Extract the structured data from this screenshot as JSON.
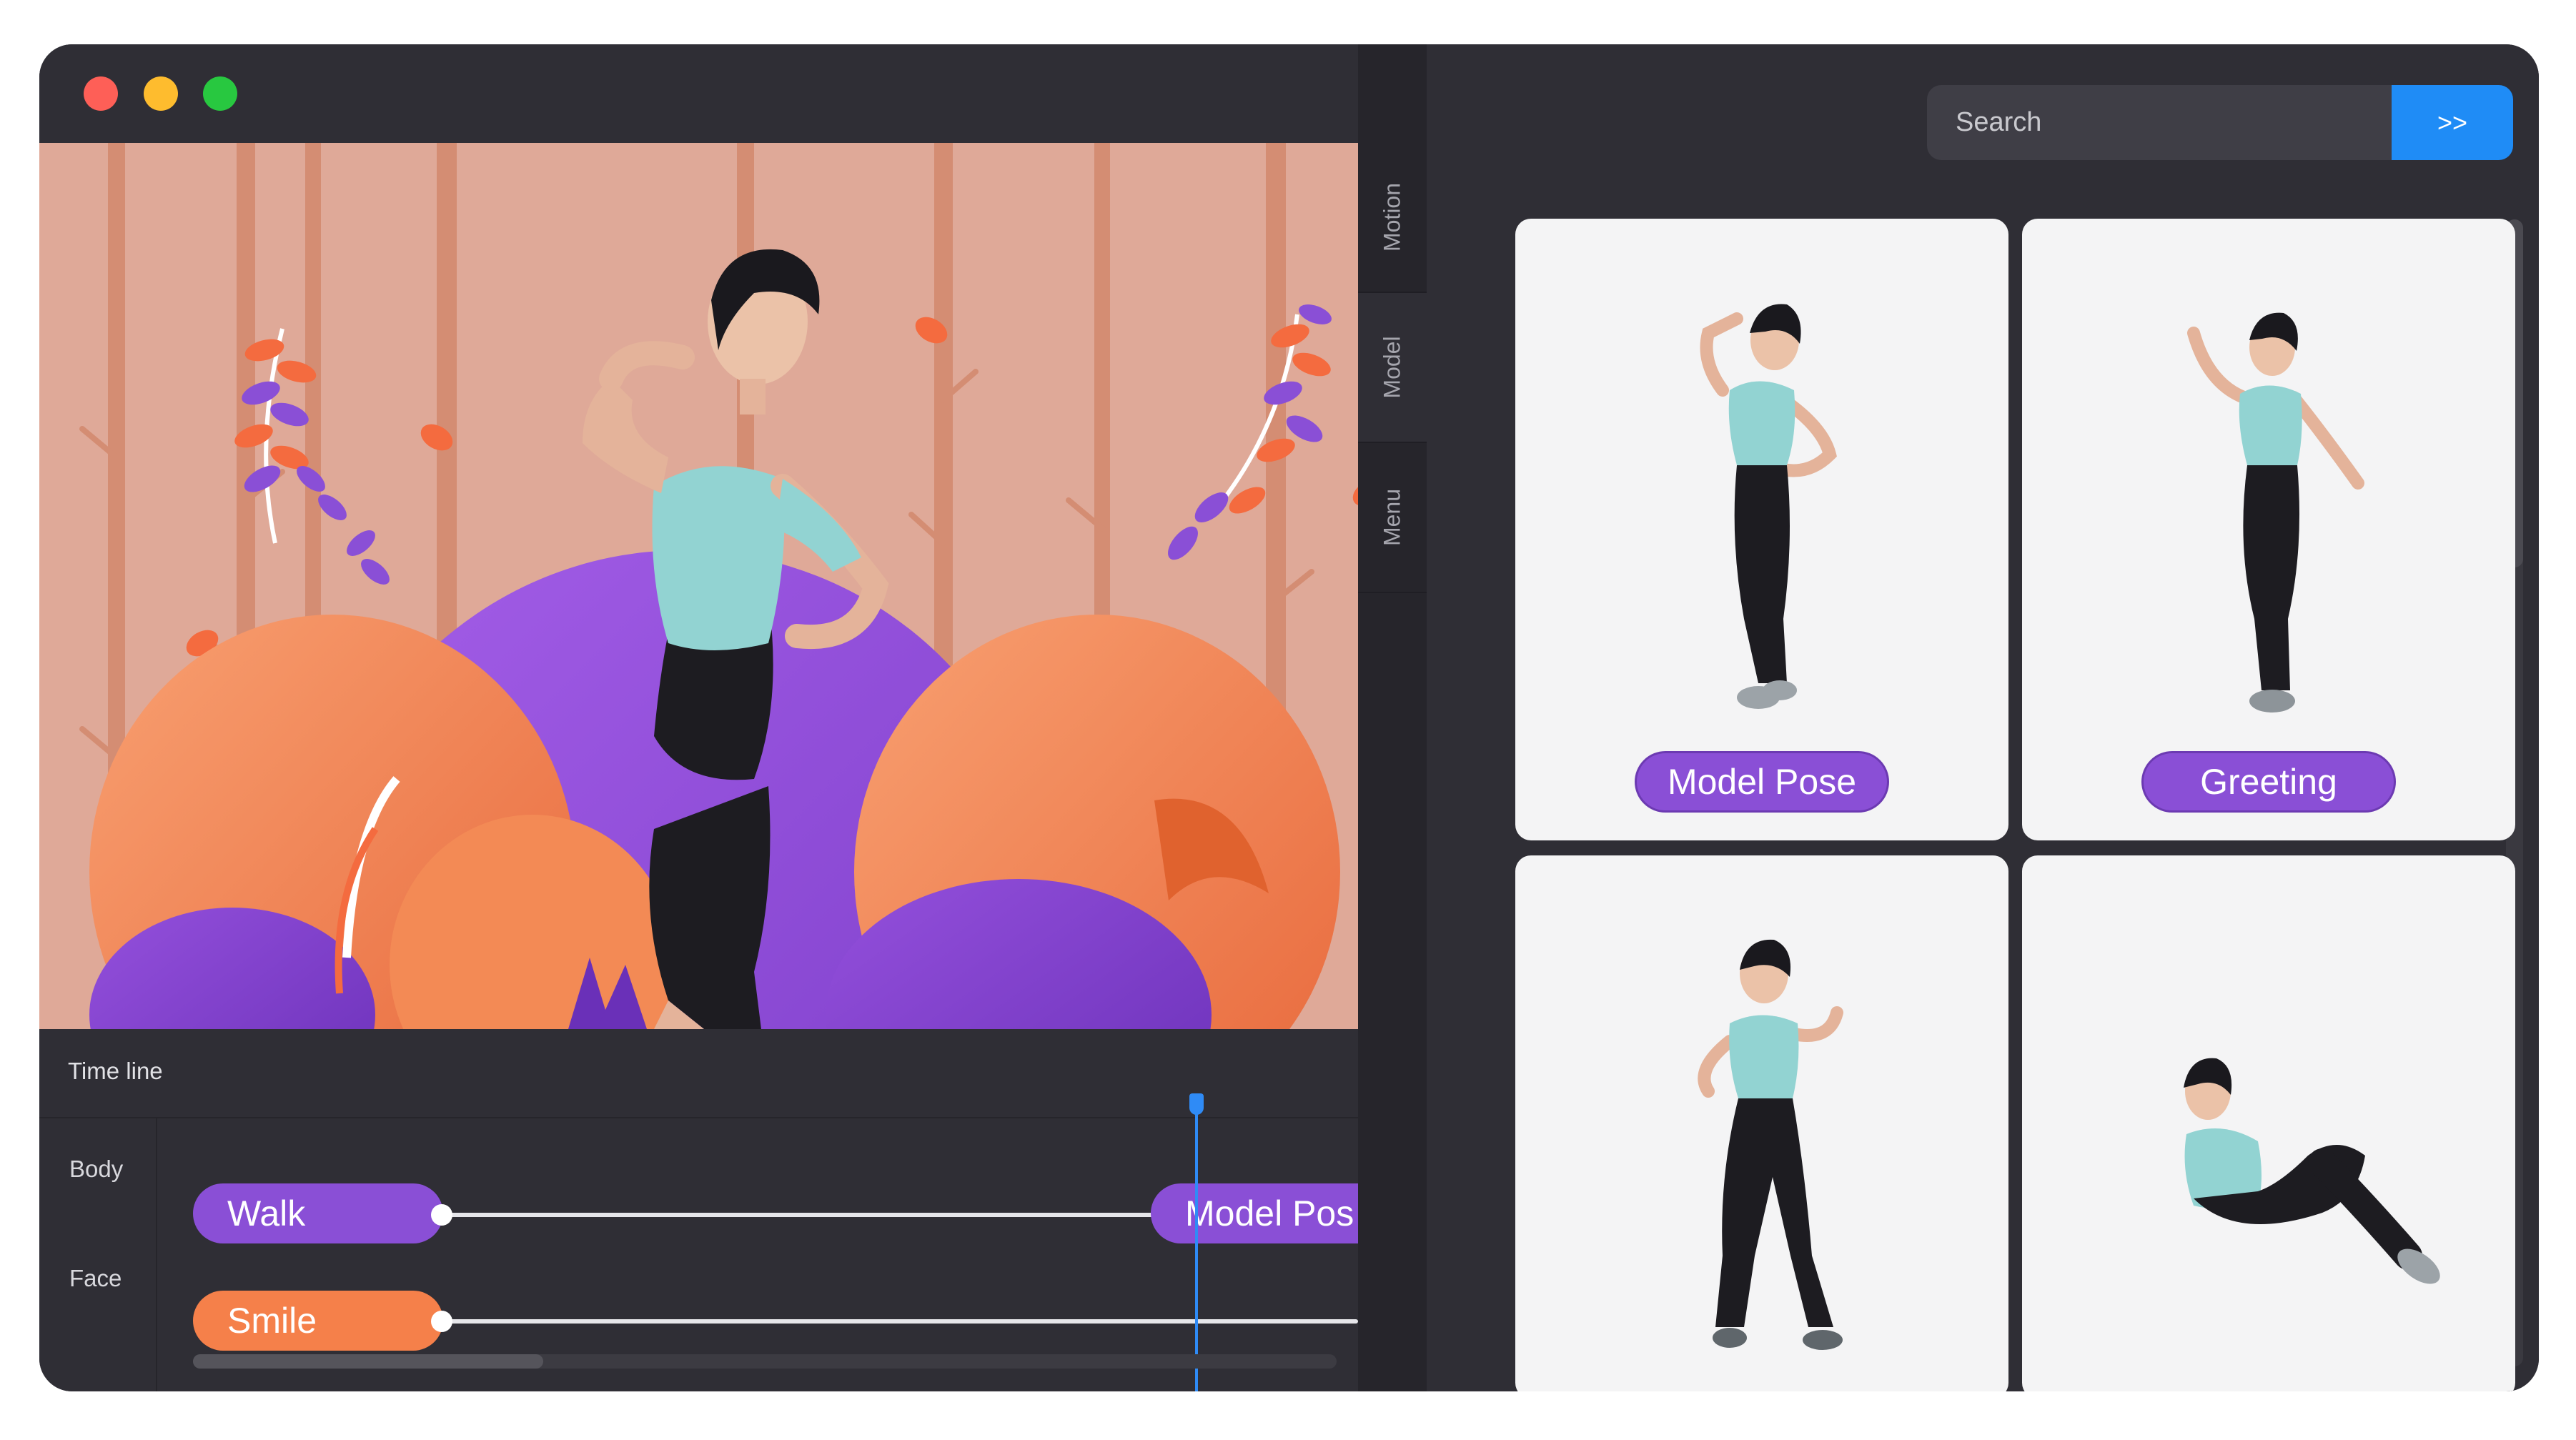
{
  "window": {
    "controls": [
      "close",
      "minimize",
      "maximize"
    ]
  },
  "scene": {
    "description_icon": "character-viewport-icon"
  },
  "timeline": {
    "title": "Time line",
    "rows": [
      {
        "label": "Body",
        "clips": [
          "Walk",
          "Model Pos"
        ]
      },
      {
        "label": "Face",
        "clips": [
          "Smile"
        ]
      }
    ]
  },
  "side_tabs": [
    "Motion",
    "Model",
    "Menu"
  ],
  "search": {
    "placeholder": "Search",
    "button_label": ">>"
  },
  "gallery": {
    "cards": [
      {
        "label": "Model Pose"
      },
      {
        "label": "Greeting"
      },
      {
        "label": ""
      },
      {
        "label": ""
      }
    ]
  },
  "colors": {
    "window_bg": "#2f2e35",
    "accent_purple": "#8a4fd6",
    "accent_orange": "#f5804a",
    "accent_blue": "#1f8cf6",
    "scene_bg": "#dfa998"
  }
}
